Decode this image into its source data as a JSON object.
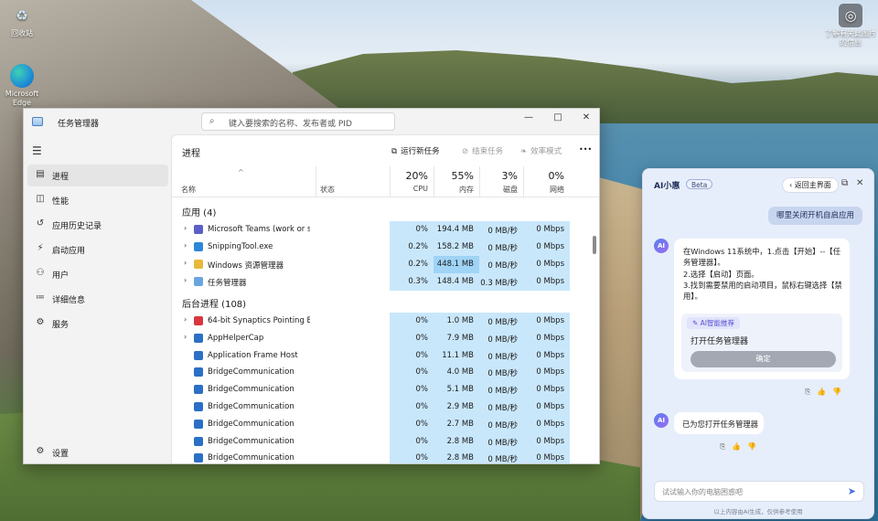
{
  "desktop": {
    "icons": [
      {
        "label": "回收站",
        "symbol": "recycle-bin"
      },
      {
        "label": "Microsoft Edge",
        "symbol": "edge"
      },
      {
        "label": "了解有关此图片的信息",
        "symbol": "info"
      }
    ]
  },
  "task_manager": {
    "title": "任务管理器",
    "search_placeholder": "键入要搜索的名称、发布者或 PID",
    "window_controls": {
      "minimize": "—",
      "maximize": "□",
      "close": "✕"
    },
    "sidebar": {
      "items": [
        {
          "label": "进程",
          "icon": "processes-icon",
          "active": true
        },
        {
          "label": "性能",
          "icon": "performance-icon"
        },
        {
          "label": "应用历史记录",
          "icon": "history-icon"
        },
        {
          "label": "启动应用",
          "icon": "startup-icon"
        },
        {
          "label": "用户",
          "icon": "users-icon"
        },
        {
          "label": "详细信息",
          "icon": "details-icon"
        },
        {
          "label": "服务",
          "icon": "services-icon"
        }
      ],
      "settings_label": "设置"
    },
    "page_title": "进程",
    "toolbar": {
      "run_new_task": "运行新任务",
      "end_task": "结束任务",
      "efficiency_mode": "效率模式",
      "more": "•••"
    },
    "columns": {
      "name": "名称",
      "status": "状态",
      "cpu": {
        "percent": "20%",
        "label": "CPU"
      },
      "memory": {
        "percent": "55%",
        "label": "内存"
      },
      "disk": {
        "percent": "3%",
        "label": "磁盘"
      },
      "network": {
        "percent": "0%",
        "label": "网络"
      }
    },
    "apps_section": "应用 (4)",
    "apps": [
      {
        "name": "Microsoft Teams (work or s...",
        "cpu": "0%",
        "memory": "194.4 MB",
        "disk": "0 MB/秒",
        "network": "0 Mbps",
        "color": "#5b5fc7"
      },
      {
        "name": "SnippingTool.exe",
        "cpu": "0.2%",
        "memory": "158.2 MB",
        "disk": "0 MB/秒",
        "network": "0 Mbps",
        "color": "#2b88d8"
      },
      {
        "name": "Windows 资源管理器",
        "cpu": "0.2%",
        "memory": "448.1 MB",
        "disk": "0 MB/秒",
        "network": "0 Mbps",
        "color": "#e8b93a"
      },
      {
        "name": "任务管理器",
        "cpu": "0.3%",
        "memory": "148.4 MB",
        "disk": "0.3 MB/秒",
        "network": "0 Mbps",
        "color": "#6aa5e0"
      }
    ],
    "background_section": "后台进程 (108)",
    "background": [
      {
        "name": "64-bit Synaptics Pointing E...",
        "cpu": "0%",
        "memory": "1.0 MB",
        "disk": "0 MB/秒",
        "network": "0 Mbps",
        "color": "#d9363e",
        "expandable": true
      },
      {
        "name": "AppHelperCap",
        "cpu": "0%",
        "memory": "7.9 MB",
        "disk": "0 MB/秒",
        "network": "0 Mbps",
        "color": "#2b6fc6",
        "expandable": true
      },
      {
        "name": "Application Frame Host",
        "cpu": "0%",
        "memory": "11.1 MB",
        "disk": "0 MB/秒",
        "network": "0 Mbps",
        "color": "#2b6fc6",
        "expandable": false
      },
      {
        "name": "BridgeCommunication",
        "cpu": "0%",
        "memory": "4.0 MB",
        "disk": "0 MB/秒",
        "network": "0 Mbps",
        "color": "#2b6fc6",
        "expandable": false
      },
      {
        "name": "BridgeCommunication",
        "cpu": "0%",
        "memory": "5.1 MB",
        "disk": "0 MB/秒",
        "network": "0 Mbps",
        "color": "#2b6fc6",
        "expandable": false
      },
      {
        "name": "BridgeCommunication",
        "cpu": "0%",
        "memory": "2.9 MB",
        "disk": "0 MB/秒",
        "network": "0 Mbps",
        "color": "#2b6fc6",
        "expandable": false
      },
      {
        "name": "BridgeCommunication",
        "cpu": "0%",
        "memory": "2.7 MB",
        "disk": "0 MB/秒",
        "network": "0 Mbps",
        "color": "#2b6fc6",
        "expandable": false
      },
      {
        "name": "BridgeCommunication",
        "cpu": "0%",
        "memory": "2.8 MB",
        "disk": "0 MB/秒",
        "network": "0 Mbps",
        "color": "#2b6fc6",
        "expandable": false
      },
      {
        "name": "BridgeCommunication",
        "cpu": "0%",
        "memory": "2.8 MB",
        "disk": "0 MB/秒",
        "network": "0 Mbps",
        "color": "#2b6fc6",
        "expandable": false
      }
    ]
  },
  "assistant": {
    "logo": "AI小惠",
    "beta": "Beta",
    "back_label": "‹ 返回主界面",
    "user_message": "哪里关闭开机自启应用",
    "bot_avatar": "AI",
    "bot_reply_lines": [
      "在Windows 11系统中，1.点击【开始】--【任务管理器】。",
      "2.选择【启动】页面。",
      "3.找到需要禁用的启动项目，鼠标右键选择【禁用】。"
    ],
    "recommend_tag": "✎ AI智能推荐",
    "recommend_title": "打开任务管理器",
    "confirm_label": "确定",
    "bot_reply_2": "已为您打开任务管理器",
    "input_placeholder": "试试输入你的电脑困惑吧",
    "footer": "以上内容由AI生成，仅供参考使用",
    "accent_color": "#4a6de0"
  }
}
